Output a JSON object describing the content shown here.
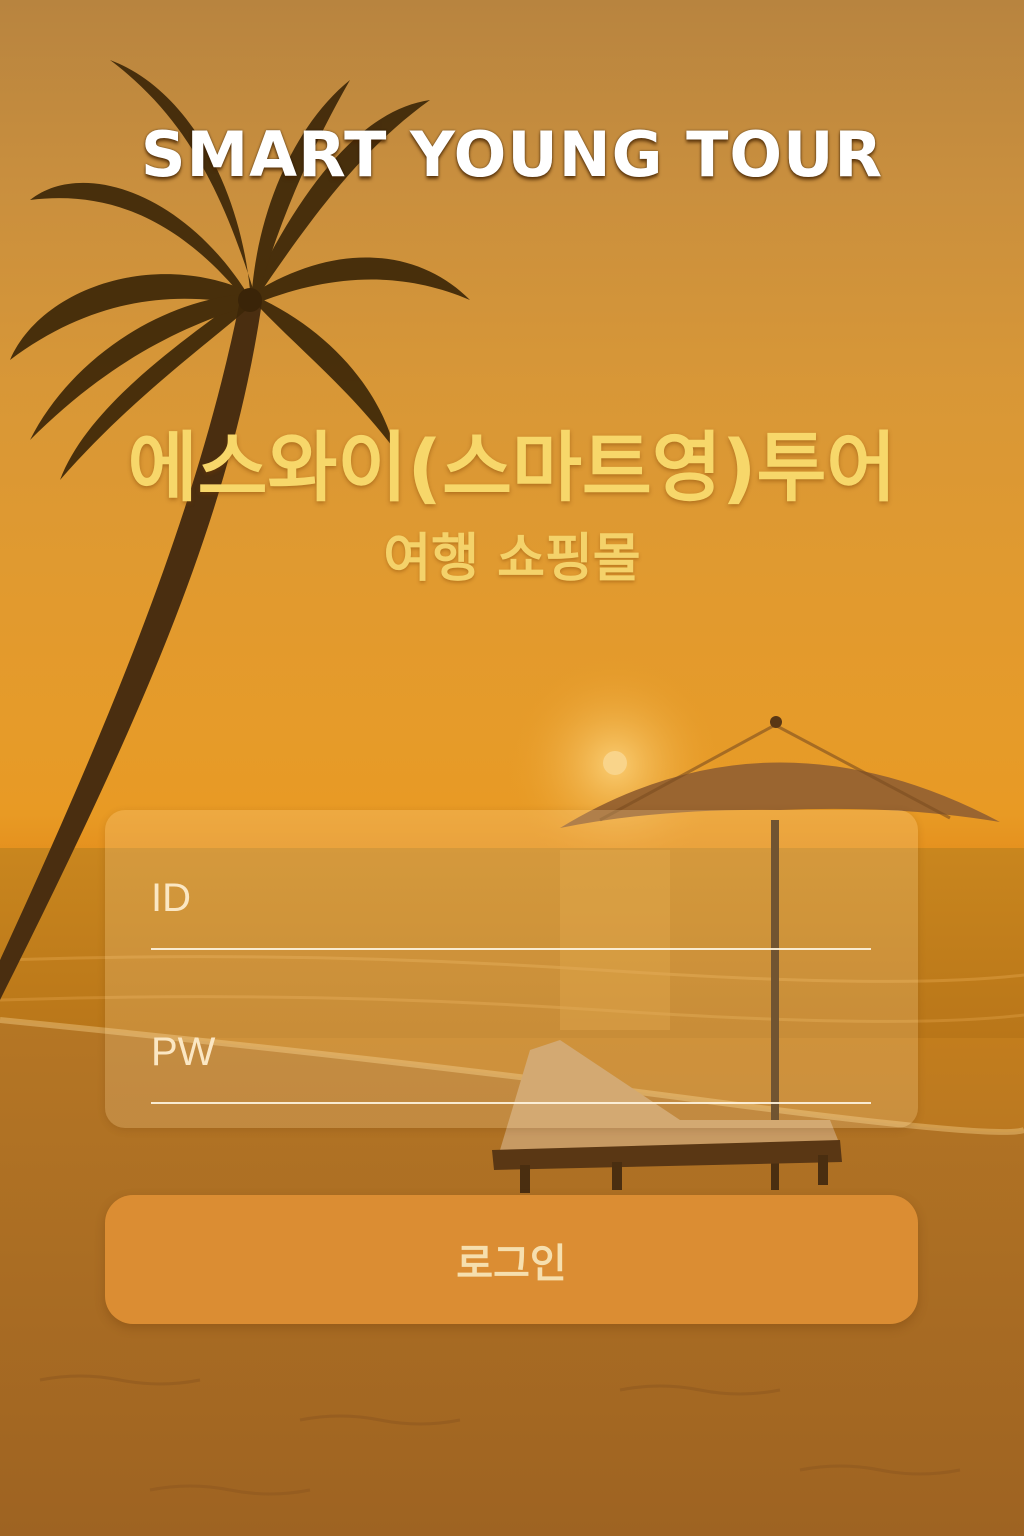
{
  "brand": {
    "title": "SMART YOUNG TOUR"
  },
  "headline": {
    "title": "에스와이(스마트영)투어",
    "subtitle": "여행 쇼핑몰"
  },
  "login_form": {
    "id_placeholder": "ID",
    "pw_placeholder": "PW",
    "submit_label": "로그인"
  },
  "colors": {
    "title_yellow": "#f7d76a",
    "button_orange": "#db8d33",
    "sky_orange": "#e69b29"
  },
  "icons": {
    "background": "palm-tree-beach-sunset-illustration"
  }
}
